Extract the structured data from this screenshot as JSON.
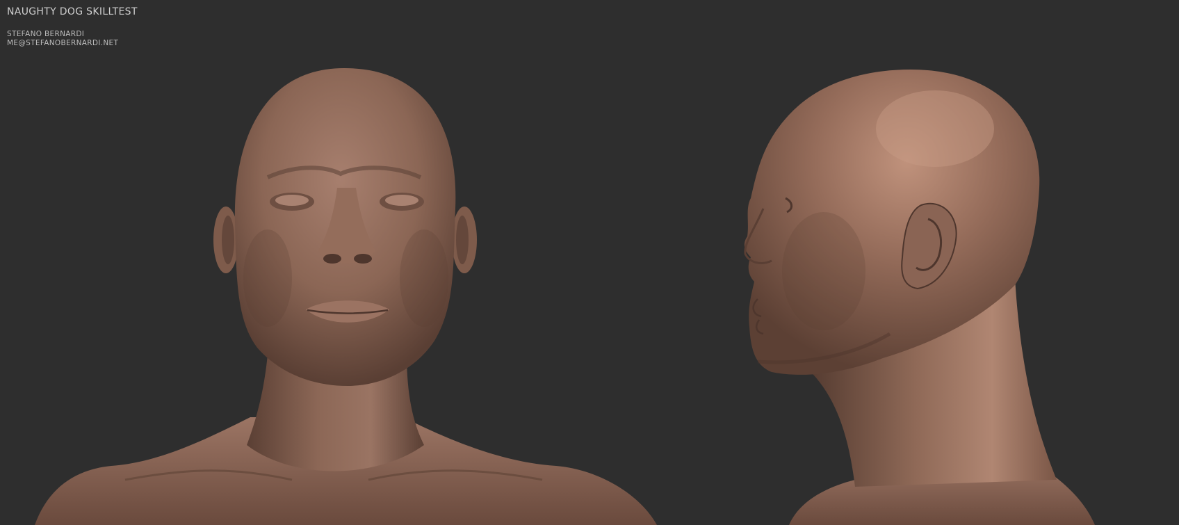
{
  "title": "NAUGHTY DOG SKILLTEST",
  "author": "STEFANO BERNARDI",
  "email": "ME@STEFANOBERNARDI.NET",
  "colors": {
    "background": "#2e2e2e",
    "clay": "#8f6a5a",
    "clay_light": "#b08775",
    "clay_dark": "#4e362d",
    "text": "#c4c4c4"
  },
  "views": [
    "front-view",
    "side-view"
  ]
}
